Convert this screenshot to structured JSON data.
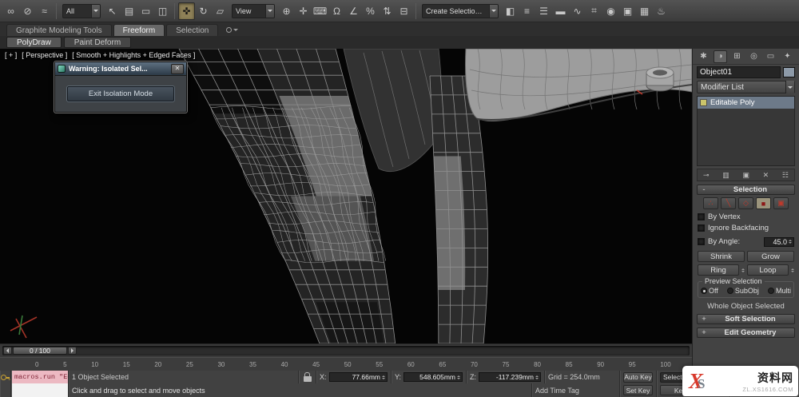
{
  "toolbar": {
    "g1": [
      {
        "name": "select-and-link-icon",
        "glyph": "∞"
      },
      {
        "name": "unlink-selection-icon",
        "glyph": "⊘"
      },
      {
        "name": "bind-to-space-warp-icon",
        "glyph": "≈"
      }
    ],
    "filter_dropdown": "All",
    "g2": [
      {
        "name": "select-object-icon",
        "glyph": "↖"
      },
      {
        "name": "select-by-name-icon",
        "glyph": "▤"
      },
      {
        "name": "rectangular-selection-region-icon",
        "glyph": "▭"
      },
      {
        "name": "window-crossing-icon",
        "glyph": "◫"
      }
    ],
    "g3": [
      {
        "name": "select-and-move-icon",
        "glyph": "✜",
        "active": true
      },
      {
        "name": "select-and-rotate-icon",
        "glyph": "↻"
      },
      {
        "name": "select-and-scale-icon",
        "glyph": "▱"
      }
    ],
    "coord_dropdown": "View",
    "g4": [
      {
        "name": "use-pivot-point-center-icon",
        "glyph": "⊕"
      },
      {
        "name": "select-and-manipulate-icon",
        "glyph": "✛"
      },
      {
        "name": "keyboard-shortcut-override-icon",
        "glyph": "⌨"
      },
      {
        "name": "snaps-toggle-icon",
        "glyph": "Ω"
      },
      {
        "name": "angle-snap-icon",
        "glyph": "∠"
      },
      {
        "name": "percent-snap-icon",
        "glyph": "%"
      },
      {
        "name": "spinner-snap-icon",
        "glyph": "⇅"
      },
      {
        "name": "edit-named-selection-sets-icon",
        "glyph": "⊟"
      }
    ],
    "named_sets_dropdown": "Create Selection Se",
    "g5": [
      {
        "name": "mirror-icon",
        "glyph": "◧"
      },
      {
        "name": "align-icon",
        "glyph": "≡"
      },
      {
        "name": "layer-manager-icon",
        "glyph": "☰"
      },
      {
        "name": "ribbon-toggle-icon",
        "glyph": "▬"
      },
      {
        "name": "curve-editor-icon",
        "glyph": "∿"
      },
      {
        "name": "schematic-view-icon",
        "glyph": "⌗"
      },
      {
        "name": "material-editor-icon",
        "glyph": "◉"
      },
      {
        "name": "render-setup-icon",
        "glyph": "▣"
      },
      {
        "name": "rendered-frame-window-icon",
        "glyph": "▦"
      },
      {
        "name": "render-production-icon",
        "glyph": "♨"
      }
    ]
  },
  "ribbon": {
    "tabs": [
      {
        "name": "tab-graphite-modeling-tools",
        "label": "Graphite Modeling Tools"
      },
      {
        "name": "tab-freeform",
        "label": "Freeform",
        "active": true
      },
      {
        "name": "tab-selection",
        "label": "Selection"
      }
    ],
    "subtabs": [
      {
        "name": "subtab-polydraw",
        "label": "PolyDraw",
        "active": true
      },
      {
        "name": "subtab-paint-deform",
        "label": "Paint Deform"
      }
    ]
  },
  "viewport": {
    "menu_general": "[ + ]",
    "menu_pov": "[ Perspective ]",
    "menu_shading": "[ Smooth + Highlights + Edged Faces ]"
  },
  "dialog": {
    "title": "Warning: Isolated Sel...",
    "close_glyph": "✕",
    "button": "Exit Isolation Mode"
  },
  "command_panel": {
    "tabs": [
      {
        "name": "command-tab-create",
        "glyph": "✱"
      },
      {
        "name": "command-tab-modify",
        "glyph": "◑",
        "active": true
      },
      {
        "name": "command-tab-hierarchy",
        "glyph": "⊞"
      },
      {
        "name": "command-tab-motion",
        "glyph": "◎"
      },
      {
        "name": "command-tab-display",
        "glyph": "▭"
      },
      {
        "name": "command-tab-utilities",
        "glyph": "✦"
      }
    ],
    "object_name": "Object01",
    "modifier_list": "Modifier List",
    "stack": [
      {
        "name": "stack-item-editable-poly",
        "label": "Editable Poly",
        "active": true
      }
    ],
    "stack_tools": [
      {
        "name": "pin-stack-icon",
        "glyph": "⊸"
      },
      {
        "name": "show-end-result-icon",
        "glyph": "▥"
      },
      {
        "name": "make-unique-icon",
        "glyph": "▣"
      },
      {
        "name": "remove-modifier-icon",
        "glyph": "✕"
      },
      {
        "name": "configure-modifier-sets-icon",
        "glyph": "☷"
      }
    ],
    "selection": {
      "indicator": "-",
      "title": "Selection",
      "subobj": [
        {
          "name": "subobject-vertex-icon",
          "glyph": "∴"
        },
        {
          "name": "subobject-edge-icon",
          "glyph": "╲"
        },
        {
          "name": "subobject-border-icon",
          "glyph": "◇"
        },
        {
          "name": "subobject-polygon-icon",
          "glyph": "■",
          "active": true
        },
        {
          "name": "subobject-element-icon",
          "glyph": "▣"
        }
      ],
      "by_vertex": "By Vertex",
      "ignore_backfacing": "Ignore Backfacing",
      "by_angle": "By Angle:",
      "angle_value": "45.0",
      "shrink": "Shrink",
      "grow": "Grow",
      "ring": "Ring",
      "loop": "Loop",
      "preview_title": "Preview Selection",
      "preview_options": [
        {
          "name": "preview-off-radio",
          "label": "Off",
          "active": true
        },
        {
          "name": "preview-subobj-radio",
          "label": "SubObj"
        },
        {
          "name": "preview-multi-radio",
          "label": "Multi"
        }
      ],
      "status": "Whole Object Selected"
    },
    "rollouts": [
      {
        "name": "soft-selection-rollout",
        "indicator": "+",
        "label": "Soft Selection"
      },
      {
        "name": "edit-geometry-rollout",
        "indicator": "+",
        "label": "Edit Geometry"
      }
    ]
  },
  "timeline": {
    "slider_label": "0 / 100",
    "ticks": [
      "0",
      "5",
      "10",
      "15",
      "20",
      "25",
      "30",
      "35",
      "40",
      "45",
      "50",
      "55",
      "60",
      "65",
      "70",
      "75",
      "80",
      "85",
      "90",
      "95",
      "100"
    ]
  },
  "status_bar": {
    "macro_text": "macros.run \"Ed",
    "selection_status": "1 Object Selected",
    "x_label": "X:",
    "x_value": "77.66mm",
    "y_label": "Y:",
    "y_value": "548.605mm",
    "z_label": "Z:",
    "z_value": "-117.239mm",
    "grid_label": "Grid = 254.0mm",
    "prompt": "Click and drag to select and move objects",
    "add_time_tag": "Add Time Tag",
    "auto_key": "Auto Key",
    "selected_dropdown": "Selected",
    "set_key": "Set Key",
    "key_filters": "Key Filters..."
  },
  "watermark": {
    "logo_x": "X",
    "logo_s": "S",
    "site_name": "资料网",
    "url": "ZL.XS1616.COM"
  }
}
